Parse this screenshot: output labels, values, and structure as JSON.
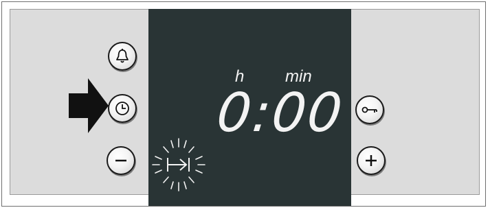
{
  "display": {
    "hours_label": "h",
    "minutes_label": "min",
    "time": "0:00"
  },
  "buttons": {
    "left": [
      "bell-icon",
      "clock-icon",
      "minus-icon"
    ],
    "right": [
      "key-icon",
      "plus-icon"
    ]
  },
  "indicator": {
    "pointer_arrow_target": "clock-icon",
    "blinking_symbol": "cooking-time-end-icon"
  },
  "colors": {
    "display_bg": "#293435",
    "panel_bg": "#dcdcdc",
    "display_text": "#f3f3f3"
  }
}
